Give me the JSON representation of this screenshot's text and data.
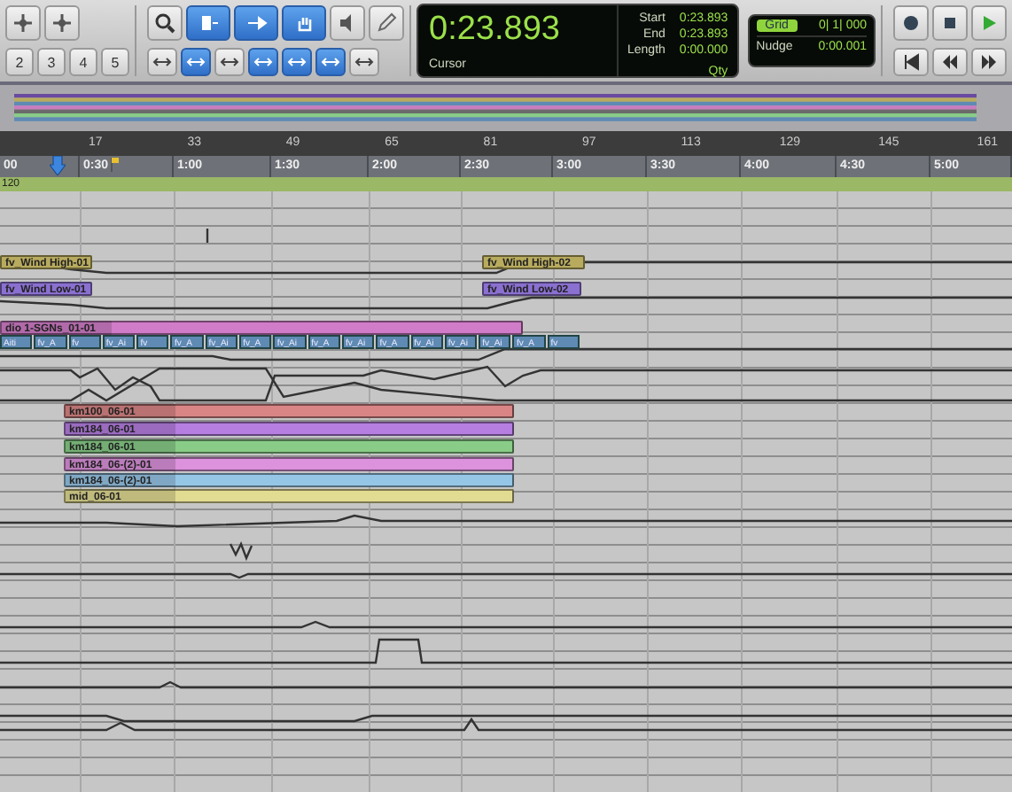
{
  "toolbar": {
    "zoom_presets": [
      "2",
      "3",
      "4",
      "5"
    ],
    "tools": [
      {
        "selected": false
      },
      {
        "selected": true
      },
      {
        "selected": true
      },
      {
        "selected": true
      },
      {
        "selected": false
      },
      {
        "selected": false
      }
    ],
    "edit_buttons": [
      {
        "selected": false
      },
      {
        "selected": true
      },
      {
        "selected": false
      },
      {
        "selected": true
      },
      {
        "selected": true
      },
      {
        "selected": true
      },
      {
        "selected": false
      }
    ]
  },
  "counter": {
    "main": "0:23.893",
    "main_label": "Cursor",
    "start_label": "Start",
    "start": "0:23.893",
    "end_label": "End",
    "end": "0:23.893",
    "length_label": "Length",
    "length": "0:00.000",
    "qty": "Qty"
  },
  "grid": {
    "grid_label": "Grid",
    "grid_on": true,
    "grid_value": "0| 1| 000",
    "nudge_label": "Nudge",
    "nudge_value": "0:00.001"
  },
  "ruler": {
    "bars": [
      "17",
      "33",
      "49",
      "65",
      "81",
      "97",
      "113",
      "129",
      "145",
      "161"
    ],
    "timecode": [
      "00",
      "0:30",
      "1:00",
      "1:30",
      "2:00",
      "2:30",
      "3:00",
      "3:30",
      "4:00",
      "4:30",
      "5:00"
    ],
    "tempo": "120"
  },
  "clips": [
    {
      "label": "fv_Wind High-01",
      "color": "#b8ab5e"
    },
    {
      "label": "fv_Wind High-02",
      "color": "#b8ab5e"
    },
    {
      "label": "fv_Wind Low-01",
      "color": "#8a70d0"
    },
    {
      "label": "fv_Wind Low-02",
      "color": "#8a70d0"
    },
    {
      "label": "dio 1-SGNs_01-01",
      "color": "#d07cc8"
    },
    {
      "label": "km100_06-01",
      "color": "#d98585"
    },
    {
      "label": "km184_06-01",
      "color": "#b57ee0"
    },
    {
      "label": "km184_06-01",
      "color": "#88cc88"
    },
    {
      "label": "km184_06-(2)-01",
      "color": "#dc92dc"
    },
    {
      "label": "km184_06-(2)-01",
      "color": "#96c6e6"
    },
    {
      "label": "mid_06-01",
      "color": "#e2dc92"
    }
  ],
  "small_clips": {
    "color": "#5f8ab4",
    "labels": [
      "Aiti",
      "fv_A",
      "fv",
      "fv_Ai",
      "fv",
      "fv_A",
      "fv_Ai",
      "fv_A",
      "fv_Ai",
      "fv_A",
      "fv_Ai",
      "fv_A",
      "fv_Ai",
      "fv_Ai",
      "fv_Ai",
      "fv_A",
      "fv"
    ]
  }
}
